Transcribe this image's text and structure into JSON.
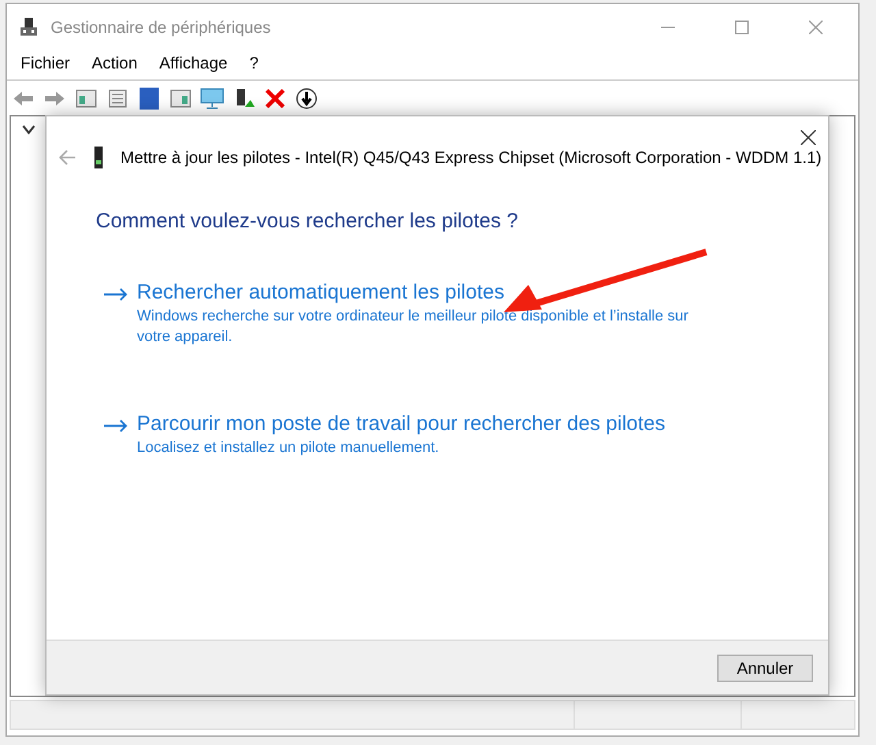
{
  "window": {
    "title": "Gestionnaire de périphériques"
  },
  "menu": [
    "Fichier",
    "Action",
    "Affichage",
    "?"
  ],
  "dialog": {
    "title": "Mettre à jour les pilotes - Intel(R) Q45/Q43 Express Chipset (Microsoft Corporation - WDDM 1.1)",
    "heading": "Comment voulez-vous rechercher les pilotes ?",
    "options": [
      {
        "title": "Rechercher automatiquement les pilotes",
        "description": "Windows recherche sur votre ordinateur le meilleur pilote disponible et l’installe sur votre appareil."
      },
      {
        "title": "Parcourir mon poste de travail pour rechercher des pilotes",
        "description": "Localisez et installez un pilote manuellement."
      }
    ],
    "buttons": [
      "Annuler"
    ]
  }
}
